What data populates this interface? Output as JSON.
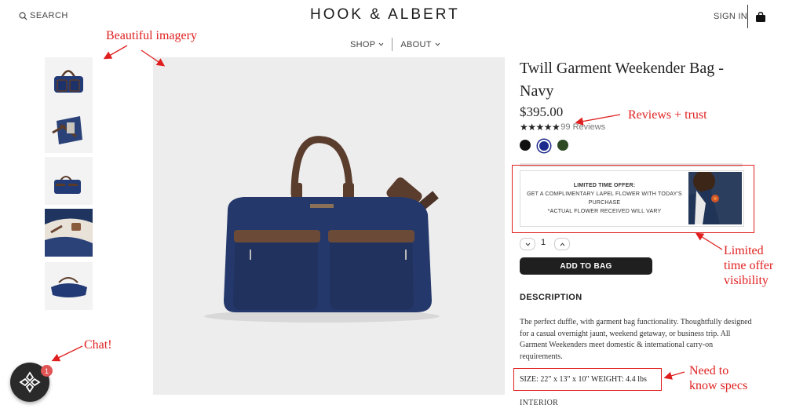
{
  "header": {
    "search_label": "SEARCH",
    "logo": "HOOK & ALBERT",
    "nav": [
      {
        "label": "SHOP"
      },
      {
        "label": "ABOUT"
      }
    ],
    "sign_in": "SIGN IN"
  },
  "product": {
    "title": "Twill Garment Weekender Bag - Navy",
    "price": "$395.00",
    "rating_stars": "★★★★★",
    "reviews": "99 Reviews",
    "swatches": [
      {
        "name": "black",
        "color": "#111111"
      },
      {
        "name": "navy",
        "color": "#1b2a8c",
        "selected": true
      },
      {
        "name": "green",
        "color": "#2e4a25"
      }
    ],
    "offer": {
      "heading": "LIMITED TIME OFFER:",
      "line1": "GET A COMPLIMENTARY LAPEL FLOWER WITH TODAY'S PURCHASE",
      "line2": "*ACTUAL FLOWER RECEIVED WILL VARY"
    },
    "quantity": "1",
    "add_to_bag": "ADD TO BAG",
    "description_heading": "DESCRIPTION",
    "description": "The perfect duffle, with garment bag functionality. Thoughtfully designed for a casual overnight jaunt, weekend getaway, or business trip. All Garment Weekenders meet domestic & international carry-on requirements.",
    "specs": "SIZE: 22\" x 13\" x 10\"  WEIGHT: 4.4 lbs",
    "interior_heading": "INTERIOR"
  },
  "annotations": {
    "imagery": "Beautiful imagery",
    "reviews": "Reviews + trust",
    "offer": [
      "Limited",
      "time offer",
      "visibility"
    ],
    "chat": "Chat!",
    "specs": [
      "Need to",
      "know specs"
    ]
  },
  "chat": {
    "badge_count": "1"
  },
  "colors": {
    "annotation": "#e02020",
    "button_bg": "#1f1f1f",
    "badge": "#e05555"
  }
}
